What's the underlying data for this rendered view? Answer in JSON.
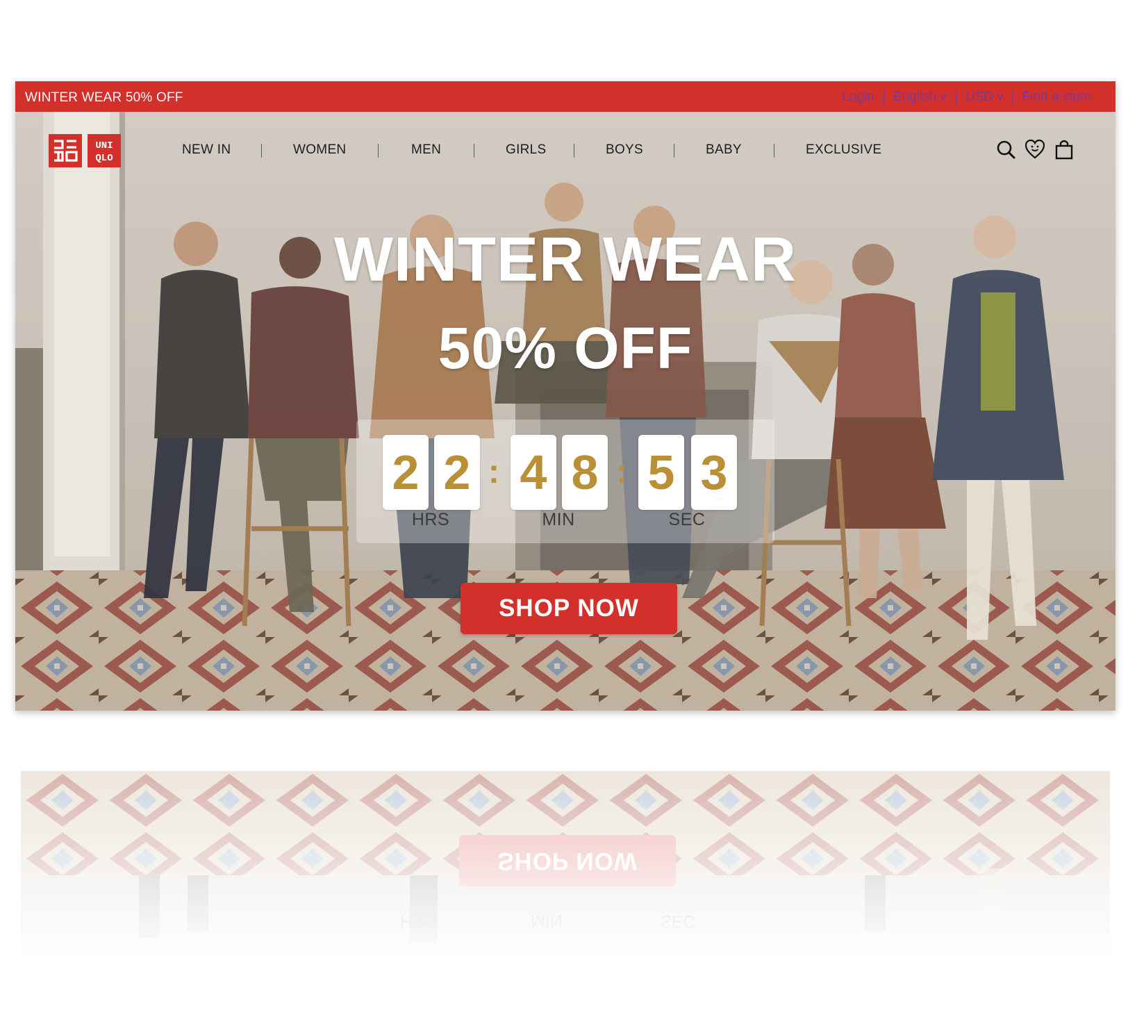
{
  "promo_bar": {
    "text": "WINTER WEAR 50% OFF"
  },
  "utility_links": [
    {
      "label": "Login"
    },
    {
      "label": "English v"
    },
    {
      "label": "USD  v"
    },
    {
      "label": "Find a store"
    }
  ],
  "logo": {
    "icon": "uniqlo-logo-icon"
  },
  "nav": {
    "items": [
      "NEW IN",
      "WOMEN",
      "MEN",
      "GIRLS",
      "BOYS",
      "BABY",
      "EXCLUSIVE"
    ]
  },
  "nav_icons": [
    "search-icon",
    "wishlist-heart-icon",
    "shopping-bag-icon"
  ],
  "hero": {
    "headline_line1": "WINTER WEAR",
    "headline_line2": "50% OFF",
    "countdown": {
      "hours": [
        "2",
        "2"
      ],
      "minutes": [
        "4",
        "8"
      ],
      "seconds": [
        "5",
        "3"
      ],
      "separator": ":",
      "labels": {
        "hours": "HRS",
        "minutes": "MIN",
        "seconds": "SEC"
      }
    },
    "cta_label": "SHOP NOW"
  },
  "colors": {
    "brand_red": "#d3302c",
    "countdown_digit": "#b99036",
    "util_link": "#7a3a93"
  }
}
